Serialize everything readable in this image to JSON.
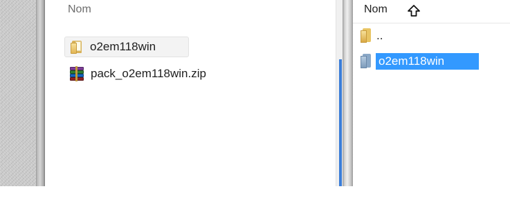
{
  "left_pane": {
    "column_header": "Nom",
    "items": [
      {
        "name": "o2em118win",
        "icon": "folder-icon"
      },
      {
        "name": "pack_o2em118win.zip",
        "icon": "winrar-archive-icon"
      }
    ]
  },
  "right_pane": {
    "column_header": "Nom",
    "sort_icon": "sort-ascending-arrow-icon",
    "items": [
      {
        "name": "..",
        "icon": "folder-icon"
      },
      {
        "name": "o2em118win",
        "icon": "folder-icon",
        "selected": true
      }
    ]
  },
  "colors": {
    "selection": "#3399ff",
    "scrollbar": "#3b7dd8"
  }
}
